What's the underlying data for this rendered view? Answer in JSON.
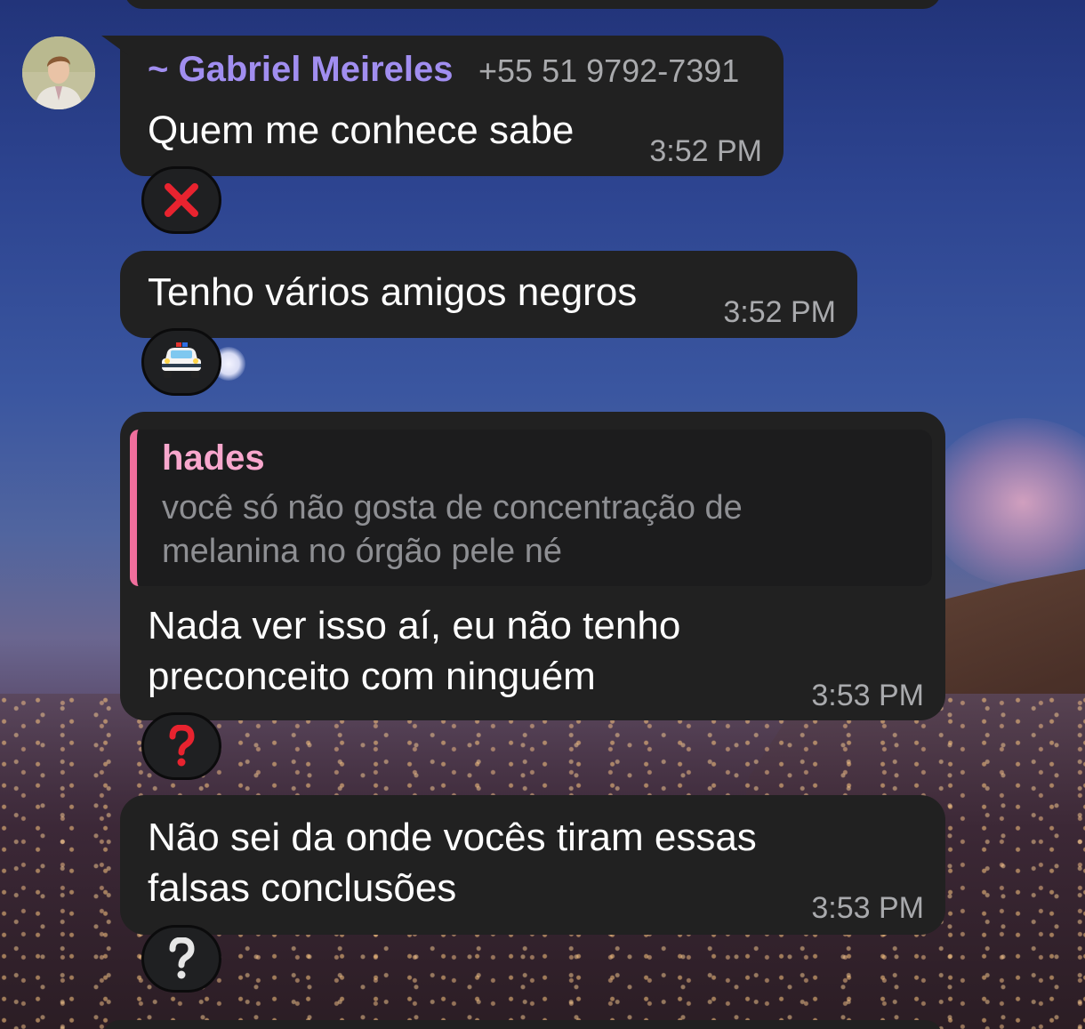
{
  "messages": [
    {
      "sender_name": "~ Gabriel Meireles",
      "sender_phone": "+55 51 9792-7391",
      "text": "Quem me conhece sabe",
      "time": "3:52 PM",
      "reaction": "cross-mark-icon"
    },
    {
      "text": "Tenho vários amigos negros",
      "time": "3:52 PM",
      "reaction": "police-car-icon"
    },
    {
      "reply_to": {
        "name": "hades",
        "text_line1": "você só não gosta de concentração de",
        "text_line2": "melanina no órgão pele né"
      },
      "text_line1": "Nada ver isso aí, eu não tenho",
      "text_line2": "preconceito com ninguém",
      "time": "3:53 PM",
      "reaction": "red-question-mark-icon"
    },
    {
      "text_line1": "Não sei da onde vocês tiram essas",
      "text_line2": "falsas conclusões",
      "time": "3:53 PM",
      "reaction": "white-question-mark-icon"
    }
  ],
  "colors": {
    "bubble_bg": "#212121",
    "sender_name": "#a18ef0",
    "reply_accent": "#f06e9c",
    "reply_name": "#f8a7cd",
    "time": "#a9aaad"
  }
}
